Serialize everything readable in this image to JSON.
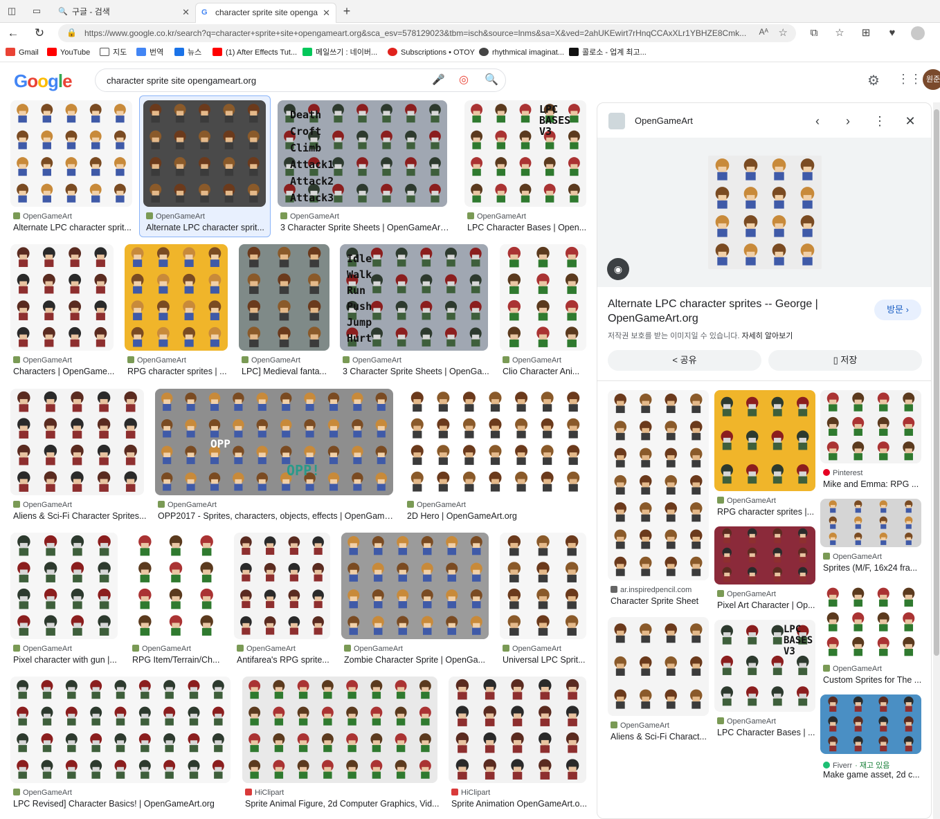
{
  "tabs": [
    {
      "label": "구글 - 검색",
      "active": false
    },
    {
      "label": "character sprite site opengamear",
      "active": true
    }
  ],
  "addressbar": {
    "url": "https://www.google.co.kr/search?q=character+sprite+site+opengameart.org&sca_esv=578129023&tbm=isch&source=lnms&sa=X&ved=2ahUKEwirt7rHnqCCAxXLr1YBHZE8Cmk...",
    "reader": "Aᴬ"
  },
  "bookmarks": [
    {
      "label": "Gmail",
      "color": "#ea4335"
    },
    {
      "label": "YouTube",
      "color": "#ff0000"
    },
    {
      "label": "지도",
      "color": "#5f6368"
    },
    {
      "label": "번역",
      "color": "#4285f4"
    },
    {
      "label": "뉴스",
      "color": "#1a73e8"
    },
    {
      "label": "(1) After Effects Tut...",
      "color": "#ff0000"
    },
    {
      "label": "메일쓰기 : 네이버...",
      "color": "#03c75a"
    },
    {
      "label": "Subscriptions • OTOY",
      "color": "#e0221d"
    },
    {
      "label": "rhythmical imaginat...",
      "color": "#444"
    },
    {
      "label": "콜로소 - 업계 최고...",
      "color": "#111"
    }
  ],
  "google": {
    "logo": "Google",
    "query": "character sprite site opengameart.org",
    "avatar": "원준"
  },
  "results": [
    {
      "source": "OpenGameArt",
      "title": "Alternate LPC character sprit...",
      "bg": "#f6f6f6"
    },
    {
      "source": "OpenGameArt",
      "title": "Alternate LPC character sprit...",
      "bg": "#4a4a4a"
    },
    {
      "source": "OpenGameArt",
      "title": "3 Character Sprite Sheets | OpenGameArt....",
      "bg": "#a0a7b2"
    },
    {
      "source": "OpenGameArt",
      "title": "LPC Character Bases | Open...",
      "bg": "#f4f4f4"
    },
    {
      "source": "OpenGameArt",
      "title": "Characters | OpenGame...",
      "bg": "#f6f6f6"
    },
    {
      "source": "OpenGameArt",
      "title": "RPG character sprites | ...",
      "bg": "#f0b52a"
    },
    {
      "source": "OpenGameArt",
      "title": "LPC] Medieval fanta...",
      "bg": "#7f8a88"
    },
    {
      "source": "OpenGameArt",
      "title": "3 Character Sprite Sheets | OpenGa...",
      "bg": "#a0a7b2"
    },
    {
      "source": "OpenGameArt",
      "title": "Clio Character Ani...",
      "bg": "#f6f6f6"
    },
    {
      "source": "OpenGameArt",
      "title": "Aliens & Sci-Fi Character Sprites...",
      "bg": "#f4f4f4"
    },
    {
      "source": "OpenGameArt",
      "title": "OPP2017 - Sprites, characters, objects, effects | OpenGame...",
      "bg": "#8e8e8e"
    },
    {
      "source": "OpenGameArt",
      "title": "2D Hero | OpenGameArt.org",
      "bg": "#ffffff"
    },
    {
      "source": "OpenGameArt",
      "title": "Pixel character with gun |...",
      "bg": "#f6f6f6"
    },
    {
      "source": "OpenGameArt",
      "title": "RPG Item/Terrain/Ch...",
      "bg": "#ffffff"
    },
    {
      "source": "OpenGameArt",
      "title": "Antifarea's RPG sprite...",
      "bg": "#f4f4f4"
    },
    {
      "source": "OpenGameArt",
      "title": "Zombie Character Sprite | OpenGa...",
      "bg": "#9b9b9b"
    },
    {
      "source": "OpenGameArt",
      "title": "Universal LPC Sprit...",
      "bg": "#f6f6f6"
    },
    {
      "source": "OpenGameArt",
      "title": "LPC Revised] Character Basics! | OpenGameArt.org",
      "bg": "#f6f6f6"
    },
    {
      "source": "HiClipart",
      "title": "Sprite Animal Figure, 2d Computer Graphics, Vid...",
      "bg": "#e9e9e9"
    },
    {
      "source": "HiClipart",
      "title": "Sprite Animation OpenGameArt.o...",
      "bg": "#f2f2f2"
    }
  ],
  "sheet_labels_a": [
    "Death",
    "Croft",
    "Climb",
    "Attack1",
    "Attack2",
    "Attack3"
  ],
  "sheet_labels_b": [
    "Idle",
    "Walk",
    "Run",
    "Push",
    "Jump",
    "Hurt"
  ],
  "lpc_badge": [
    "LPC",
    "BASES",
    "V3"
  ],
  "opp_banner": [
    "OPP",
    "OPP!"
  ],
  "panel": {
    "site": "OpenGameArt",
    "title": "Alternate LPC character sprites -- George | OpenGameArt.org",
    "visit": "방문 ›",
    "copyright": "저작권 보호를 받는 이미지일 수 있습니다.",
    "learn_more": "자세히 알아보기",
    "share": "공유",
    "save": "저장",
    "related": [
      {
        "source": "ar.inspiredpencil.com",
        "title": "Character Sprite Sheet",
        "bg": "#f6f6f6"
      },
      {
        "source": "OpenGameArt",
        "title": "RPG character sprites |...",
        "bg": "#f0b52a"
      },
      {
        "source": "Pinterest",
        "title": "Mike and Emma: RPG ...",
        "bg": "#f3f3f3"
      },
      {
        "source": "OpenGameArt",
        "title": "Pixel Art Character | Op...",
        "bg": "#8b2a3a"
      },
      {
        "source": "OpenGameArt",
        "title": "Sprites (M/F, 16x24 fra...",
        "bg": "#d5d5d5"
      },
      {
        "source": "OpenGameArt",
        "title": "Aliens & Sci-Fi Charact...",
        "bg": "#f4f4f4"
      },
      {
        "source": "OpenGameArt",
        "title": "LPC Character Bases | ...",
        "bg": "#f4f4f4"
      },
      {
        "source": "OpenGameArt",
        "title": "Custom Sprites for The ...",
        "bg": "#ffffff"
      },
      {
        "source": "Fiverr",
        "title": "Make game asset, 2d c...",
        "badge": "재고 있음",
        "bg": "#4a8fc4"
      }
    ]
  }
}
